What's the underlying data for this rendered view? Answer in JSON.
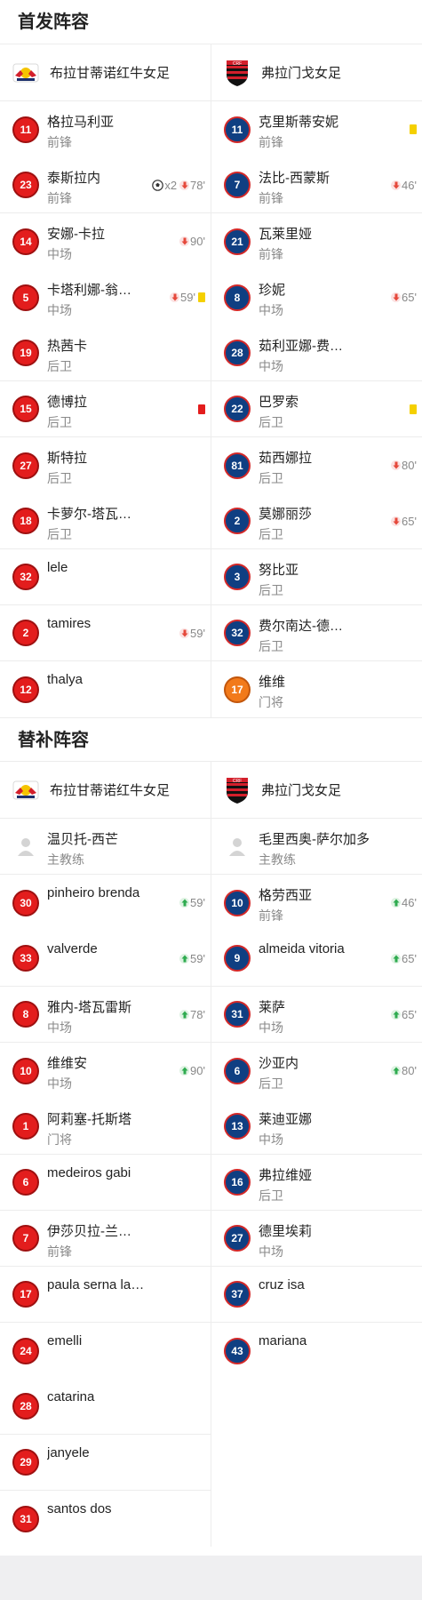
{
  "lineup_title": "首发阵容",
  "subs_title": "替补阵容",
  "colors": {
    "home": "#e31d1d",
    "away": "#0f3f82",
    "gk": "#f27a1a",
    "yellow": "#f5d000"
  },
  "home_team": "布拉甘蒂诺红牛女足",
  "away_team": "弗拉门戈女足",
  "starters": {
    "home": [
      {
        "num": "11",
        "name": "格拉马利亚",
        "pos": "前锋",
        "color": "red",
        "events": []
      },
      {
        "num": "23",
        "name": "泰斯拉内",
        "pos": "前锋",
        "color": "red",
        "events": [
          {
            "type": "goal",
            "text": "x2"
          },
          {
            "type": "out",
            "text": "78'"
          }
        ]
      },
      {
        "num": "14",
        "name": "安娜-卡拉",
        "pos": "中场",
        "color": "red",
        "events": [
          {
            "type": "out",
            "text": "90'"
          }
        ]
      },
      {
        "num": "5",
        "name": "卡塔利娜-翁…",
        "pos": "中场",
        "color": "red",
        "events": [
          {
            "type": "out",
            "text": "59'"
          },
          {
            "type": "yellow",
            "text": ""
          }
        ]
      },
      {
        "num": "19",
        "name": "热茜卡",
        "pos": "后卫",
        "color": "red",
        "events": []
      },
      {
        "num": "15",
        "name": "德博拉",
        "pos": "后卫",
        "color": "red",
        "events": [
          {
            "type": "red",
            "text": ""
          }
        ]
      },
      {
        "num": "27",
        "name": "斯特拉",
        "pos": "后卫",
        "color": "red",
        "events": []
      },
      {
        "num": "18",
        "name": "卡萝尔-塔瓦…",
        "pos": "后卫",
        "color": "red",
        "events": []
      },
      {
        "num": "32",
        "name": "lele",
        "pos": "",
        "color": "red",
        "events": []
      },
      {
        "num": "2",
        "name": "tamires",
        "pos": "",
        "color": "red",
        "events": [
          {
            "type": "out",
            "text": "59'"
          }
        ]
      },
      {
        "num": "12",
        "name": "thalya",
        "pos": "",
        "color": "red",
        "events": []
      }
    ],
    "away": [
      {
        "num": "11",
        "name": "克里斯蒂安妮",
        "pos": "前锋",
        "color": "blue",
        "events": [
          {
            "type": "yellow",
            "text": ""
          }
        ]
      },
      {
        "num": "7",
        "name": "法比-西蒙斯",
        "pos": "前锋",
        "color": "blue",
        "events": [
          {
            "type": "out",
            "text": "46'"
          }
        ]
      },
      {
        "num": "21",
        "name": "瓦莱里娅",
        "pos": "前锋",
        "color": "blue",
        "events": []
      },
      {
        "num": "8",
        "name": "珍妮",
        "pos": "中场",
        "color": "blue",
        "events": [
          {
            "type": "out",
            "text": "65'"
          }
        ]
      },
      {
        "num": "28",
        "name": "茹利亚娜-费…",
        "pos": "中场",
        "color": "blue",
        "events": []
      },
      {
        "num": "22",
        "name": "巴罗索",
        "pos": "后卫",
        "color": "blue",
        "events": [
          {
            "type": "yellow",
            "text": ""
          }
        ]
      },
      {
        "num": "81",
        "name": "茹西娜拉",
        "pos": "后卫",
        "color": "blue",
        "events": [
          {
            "type": "out",
            "text": "80'"
          }
        ]
      },
      {
        "num": "2",
        "name": "莫娜丽莎",
        "pos": "后卫",
        "color": "blue",
        "events": [
          {
            "type": "out",
            "text": "65'"
          }
        ]
      },
      {
        "num": "3",
        "name": "努比亚",
        "pos": "后卫",
        "color": "blue",
        "events": []
      },
      {
        "num": "32",
        "name": "费尔南达-德…",
        "pos": "后卫",
        "color": "blue",
        "events": []
      },
      {
        "num": "17",
        "name": "维维",
        "pos": "门将",
        "color": "orange",
        "events": []
      }
    ]
  },
  "subs": {
    "home": [
      {
        "coach": true,
        "name": "温贝托-西芒",
        "pos": "主教练",
        "events": []
      },
      {
        "num": "30",
        "name": "pinheiro brenda",
        "pos": "",
        "color": "red",
        "events": [
          {
            "type": "in",
            "text": "59'"
          }
        ]
      },
      {
        "num": "33",
        "name": "valverde",
        "pos": "",
        "color": "red",
        "events": [
          {
            "type": "in",
            "text": "59'"
          }
        ]
      },
      {
        "num": "8",
        "name": "雅内-塔瓦雷斯",
        "pos": "中场",
        "color": "red",
        "events": [
          {
            "type": "in",
            "text": "78'"
          }
        ]
      },
      {
        "num": "10",
        "name": "维维安",
        "pos": "中场",
        "color": "red",
        "events": [
          {
            "type": "in",
            "text": "90'"
          }
        ]
      },
      {
        "num": "1",
        "name": "阿莉塞-托斯塔",
        "pos": "门将",
        "color": "red",
        "events": []
      },
      {
        "num": "6",
        "name": "medeiros gabi",
        "pos": "",
        "color": "red",
        "events": []
      },
      {
        "num": "7",
        "name": "伊莎贝拉-兰…",
        "pos": "前锋",
        "color": "red",
        "events": []
      },
      {
        "num": "17",
        "name": "paula serna la…",
        "pos": "",
        "color": "red",
        "events": []
      },
      {
        "num": "24",
        "name": "emelli",
        "pos": "",
        "color": "red",
        "events": []
      },
      {
        "num": "28",
        "name": "catarina",
        "pos": "",
        "color": "red",
        "events": []
      },
      {
        "num": "29",
        "name": "janyele",
        "pos": "",
        "color": "red",
        "events": []
      },
      {
        "num": "31",
        "name": "santos dos",
        "pos": "",
        "color": "red",
        "events": []
      }
    ],
    "away": [
      {
        "coach": true,
        "name": "毛里西奥-萨尔加多",
        "pos": "主教练",
        "events": []
      },
      {
        "num": "10",
        "name": "格劳西亚",
        "pos": "前锋",
        "color": "blue",
        "events": [
          {
            "type": "in",
            "text": "46'"
          }
        ]
      },
      {
        "num": "9",
        "name": "almeida vitoria",
        "pos": "",
        "color": "blue",
        "events": [
          {
            "type": "in",
            "text": "65'"
          }
        ]
      },
      {
        "num": "31",
        "name": "莱萨",
        "pos": "中场",
        "color": "blue",
        "events": [
          {
            "type": "in",
            "text": "65'"
          }
        ]
      },
      {
        "num": "6",
        "name": "沙亚内",
        "pos": "后卫",
        "color": "blue",
        "events": [
          {
            "type": "in",
            "text": "80'"
          }
        ]
      },
      {
        "num": "13",
        "name": "莱迪亚娜",
        "pos": "中场",
        "color": "blue",
        "events": []
      },
      {
        "num": "16",
        "name": "弗拉维娅",
        "pos": "后卫",
        "color": "blue",
        "events": []
      },
      {
        "num": "27",
        "name": "德里埃莉",
        "pos": "中场",
        "color": "blue",
        "events": []
      },
      {
        "num": "37",
        "name": "cruz isa",
        "pos": "",
        "color": "blue",
        "events": []
      },
      {
        "num": "43",
        "name": "mariana",
        "pos": "",
        "color": "blue",
        "events": []
      }
    ]
  }
}
